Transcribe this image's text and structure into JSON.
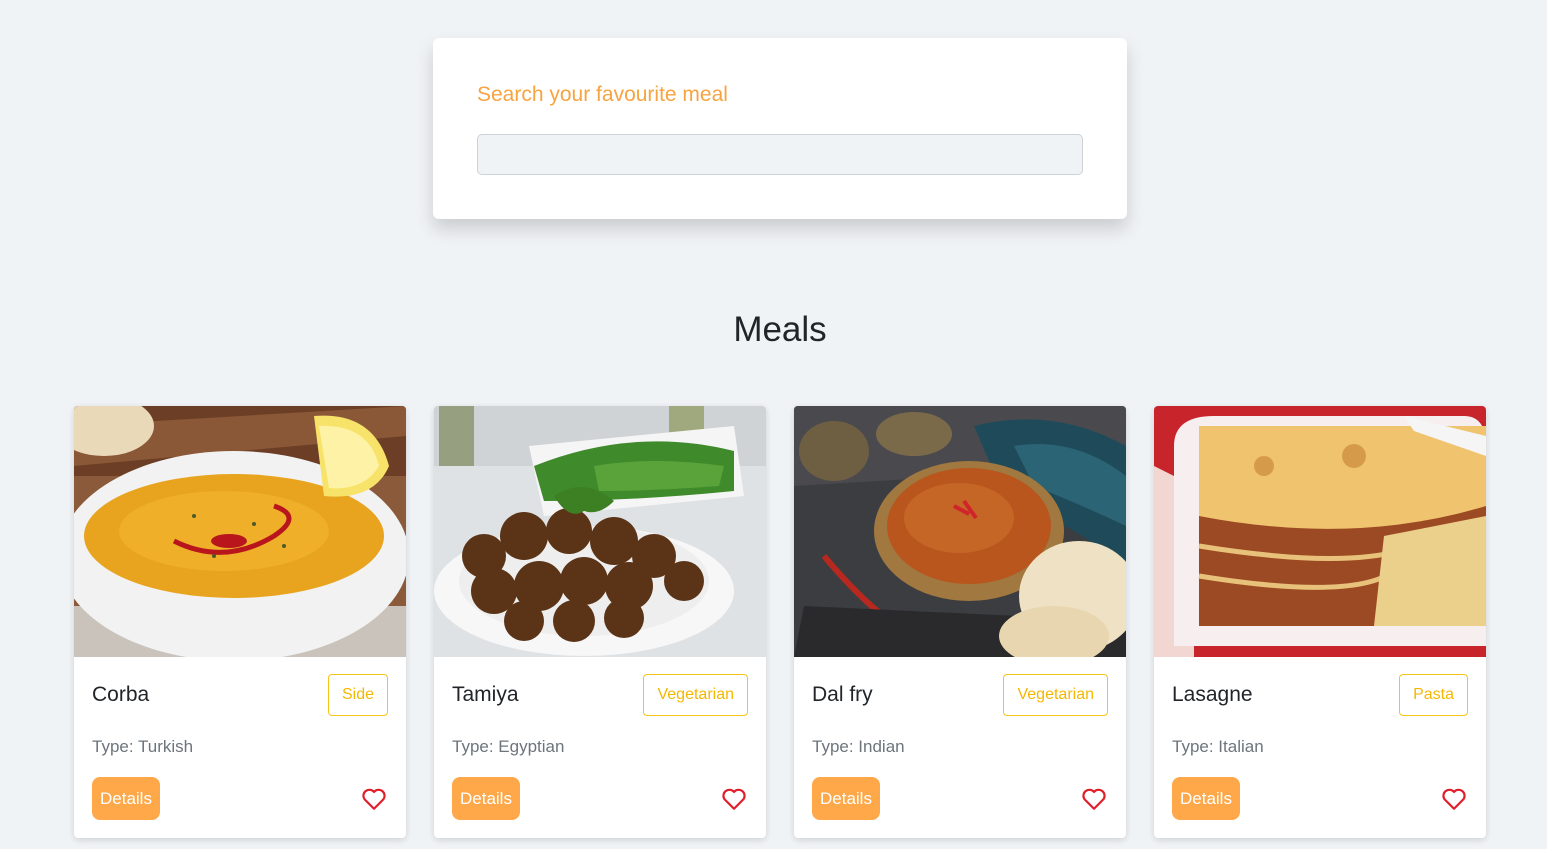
{
  "search": {
    "label": "Search your favourite meal",
    "value": "",
    "placeholder": ""
  },
  "meals_heading": "Meals",
  "meals": [
    {
      "name": "Corba",
      "tag": "Side",
      "type": "Type: Turkish",
      "details_label": "Details",
      "image": "lentil-soup-image"
    },
    {
      "name": "Tamiya",
      "tag": "Vegetarian",
      "type": "Type: Egyptian",
      "details_label": "Details",
      "image": "falafel-image"
    },
    {
      "name": "Dal fry",
      "tag": "Vegetarian",
      "type": "Type: Indian",
      "details_label": "Details",
      "image": "dal-curry-image"
    },
    {
      "name": "Lasagne",
      "tag": "Pasta",
      "type": "Type: Italian",
      "details_label": "Details",
      "image": "lasagne-image"
    }
  ],
  "colors": {
    "accent": "#ffa84a",
    "label_orange": "#f7a440",
    "tag_yellow": "#f5c518",
    "heart_red": "#e11d2a",
    "background": "#f0f3f6"
  }
}
